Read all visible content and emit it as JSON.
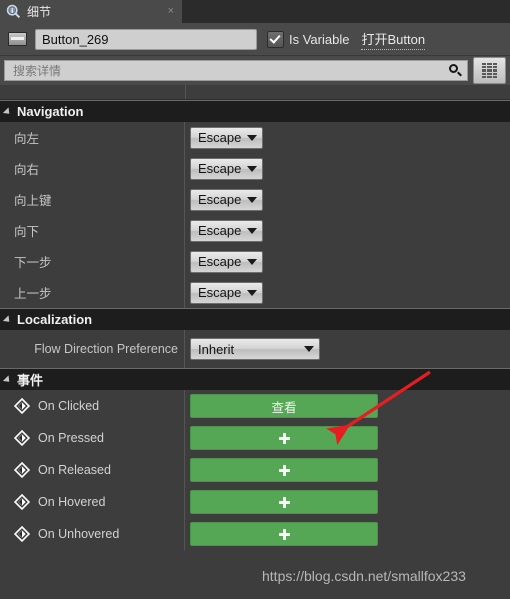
{
  "window": {
    "tab": {
      "label": "细节",
      "icon": "details-search-icon",
      "close": "×"
    }
  },
  "header": {
    "widget_icon": "widget-button-icon",
    "name_value": "Button_269",
    "name_placeholder": "Name",
    "is_variable_label": "Is Variable",
    "is_variable_checked": true,
    "open_link_label": "打开Button"
  },
  "search": {
    "placeholder": "搜索详情",
    "value": "",
    "icon": "search-icon",
    "grid_button_icon": "grid-view-icon"
  },
  "sections": [
    {
      "id": "navigation",
      "title": "Navigation",
      "expanded": true,
      "rows": [
        {
          "label": "向左",
          "value": "Escape"
        },
        {
          "label": "向右",
          "value": "Escape"
        },
        {
          "label": "向上键",
          "value": "Escape"
        },
        {
          "label": "向下",
          "value": "Escape"
        },
        {
          "label": "下一步",
          "value": "Escape"
        },
        {
          "label": "上一步",
          "value": "Escape"
        }
      ]
    },
    {
      "id": "localization",
      "title": "Localization",
      "expanded": true,
      "rows": [
        {
          "label": "Flow Direction Preference",
          "value": "Inherit"
        }
      ]
    },
    {
      "id": "events",
      "title": "事件",
      "expanded": true,
      "rows": [
        {
          "label": "On Clicked",
          "button": "查看",
          "icon": "event-diamond-icon"
        },
        {
          "label": "On Pressed",
          "button": "+",
          "icon": "event-diamond-icon"
        },
        {
          "label": "On Released",
          "button": "+",
          "icon": "event-diamond-icon"
        },
        {
          "label": "On Hovered",
          "button": "+",
          "icon": "event-diamond-icon"
        },
        {
          "label": "On Unhovered",
          "button": "+",
          "icon": "event-diamond-icon"
        }
      ]
    }
  ],
  "annotation": {
    "arrow_color": "#e81d22",
    "watermark": "https://blog.csdn.net/smallfox233"
  },
  "colors": {
    "panel_bg": "#3d3d3d",
    "section_bg": "#1d1d1d",
    "toolbar_bg": "#4a4a4a",
    "event_green": "#56a755",
    "accent_text": "#f0f0f0"
  }
}
